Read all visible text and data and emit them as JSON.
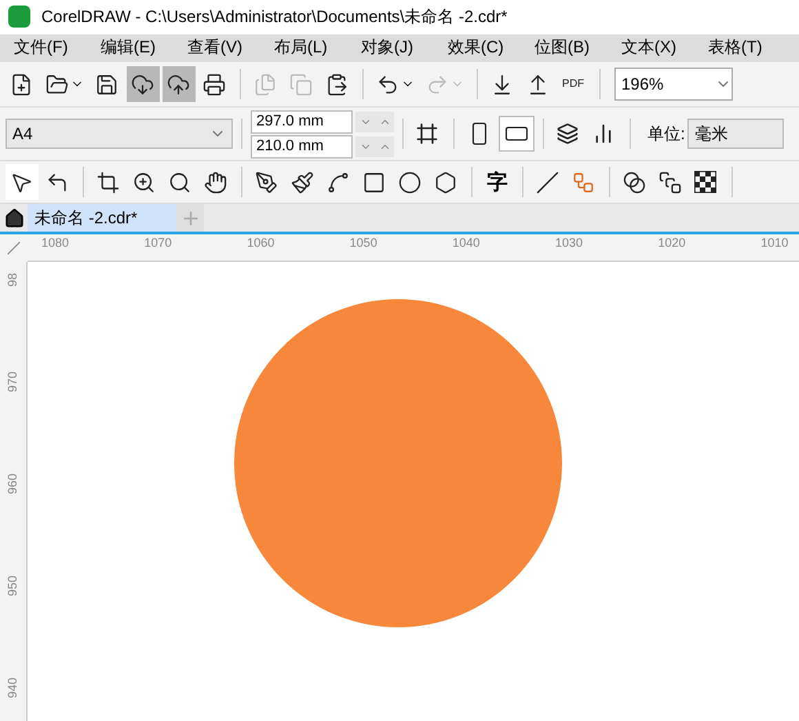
{
  "window": {
    "title": "CorelDRAW - C:\\Users\\Administrator\\Documents\\未命名 -2.cdr*"
  },
  "menu": [
    "文件(F)",
    "编辑(E)",
    "查看(V)",
    "布局(L)",
    "对象(J)",
    "效果(C)",
    "位图(B)",
    "文本(X)",
    "表格(T)"
  ],
  "toolbar": {
    "groups": [
      [
        {
          "kind": "button",
          "selected": false,
          "disabled": false
        },
        {
          "kind": "split",
          "selected": false,
          "disabled": false
        },
        {
          "kind": "button",
          "selected": false,
          "disabled": false
        },
        {
          "kind": "button",
          "selected": true,
          "disabled": false
        },
        {
          "kind": "button",
          "selected": true,
          "disabled": false
        },
        {
          "kind": "button",
          "selected": false,
          "disabled": false
        }
      ],
      [
        {
          "kind": "button",
          "selected": false,
          "disabled": true
        },
        {
          "kind": "button",
          "selected": false,
          "disabled": true
        },
        {
          "kind": "button",
          "selected": false,
          "disabled": false
        }
      ],
      [
        {
          "kind": "split",
          "selected": false,
          "disabled": false
        },
        {
          "kind": "split",
          "selected": false,
          "disabled": true
        }
      ],
      [
        {
          "kind": "button",
          "selected": false,
          "disabled": false
        },
        {
          "kind": "button",
          "selected": false,
          "disabled": false
        },
        {
          "kind": "text",
          "label": "PDF",
          "selected": false,
          "disabled": false
        }
      ]
    ],
    "zoom": "196%"
  },
  "property_bar": {
    "page_size": "A4",
    "width": "297.0 mm",
    "height": "210.0 mm",
    "orientation_buttons": [
      {
        "selected": false
      },
      {
        "selected": true
      }
    ],
    "unit_label": "单位:",
    "unit": "毫米"
  },
  "toolbox": [
    [
      {
        "kind": "tool",
        "selected": true
      },
      {
        "kind": "tool",
        "selected": false
      }
    ],
    [
      {
        "kind": "tool",
        "selected": false
      },
      {
        "kind": "tool",
        "selected": false
      },
      {
        "kind": "tool",
        "selected": false
      },
      {
        "kind": "tool",
        "selected": false
      }
    ],
    [
      {
        "kind": "tool",
        "selected": false
      },
      {
        "kind": "tool",
        "selected": false
      },
      {
        "kind": "tool",
        "selected": false
      },
      {
        "kind": "tool",
        "selected": false
      },
      {
        "kind": "tool",
        "selected": false
      },
      {
        "kind": "tool",
        "selected": false
      }
    ],
    [
      {
        "kind": "text",
        "label": "字",
        "selected": false
      }
    ],
    [
      {
        "kind": "tool",
        "selected": false
      },
      {
        "kind": "tool",
        "selected": false
      }
    ],
    [
      {
        "kind": "tool",
        "selected": false
      },
      {
        "kind": "tool",
        "selected": false
      },
      {
        "kind": "tool",
        "selected": false
      }
    ]
  ],
  "tabs": [
    {
      "label": "未命名 -2.cdr*",
      "selected": true
    }
  ],
  "ruler": {
    "horizontal": [
      "1080",
      "1070",
      "1060",
      "1050",
      "1040",
      "1030",
      "1020",
      "1010"
    ],
    "vertical": [
      "98",
      "970",
      "960",
      "950",
      "940"
    ]
  }
}
